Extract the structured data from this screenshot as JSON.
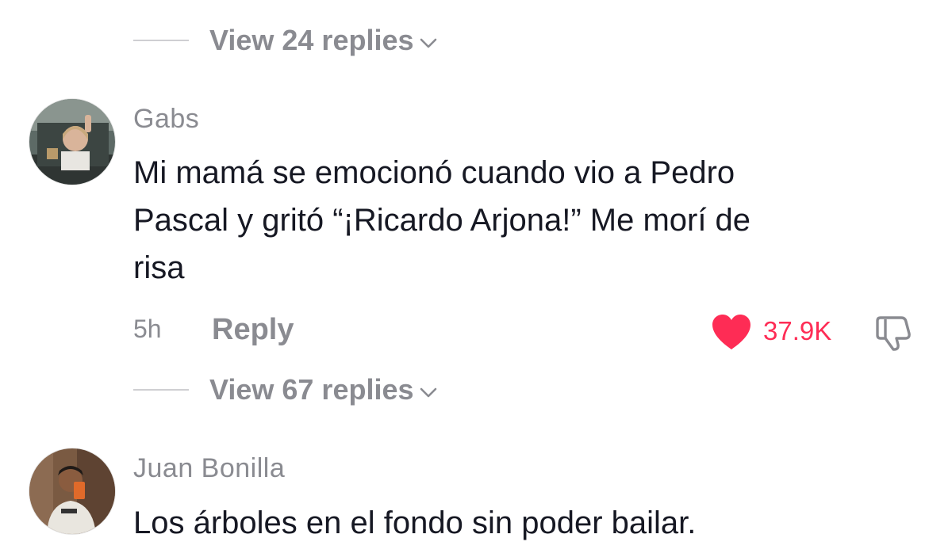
{
  "thread_top": {
    "view_replies_label": "View 24 replies"
  },
  "comments": [
    {
      "username": "Gabs",
      "text_lines": [
        "Mi mamá se emocionó cuando vio a Pedro",
        "Pascal y gritó “¡Ricardo Arjona!” Me morí de",
        "risa"
      ],
      "time": "5h",
      "reply_label": "Reply",
      "likes": "37.9K",
      "view_replies_label": "View 67 replies"
    },
    {
      "username": "Juan Bonilla",
      "text": "Los árboles en el fondo sin poder bailar."
    }
  ],
  "colors": {
    "like_red": "#fe2c55",
    "muted_gray": "#8a8b91",
    "text_dark": "#161823"
  },
  "icons": [
    "chevron-down-icon",
    "heart-icon",
    "dislike-icon"
  ]
}
